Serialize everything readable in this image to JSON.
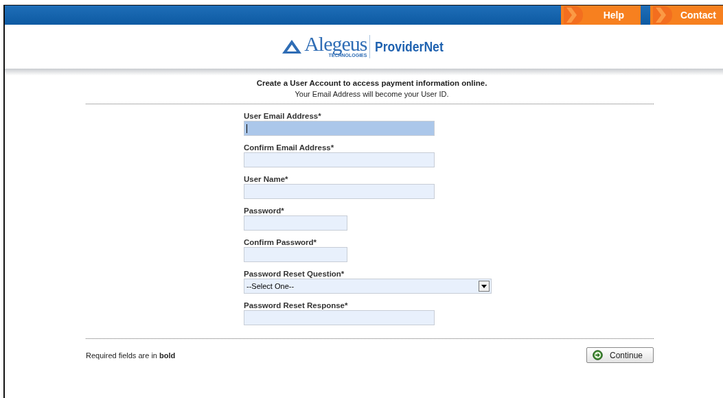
{
  "nav": [
    {
      "label": "Help"
    },
    {
      "label": "Contact"
    }
  ],
  "logo": {
    "brand": "Alegeus",
    "sub": "TECHNOLOGIES",
    "product": "ProviderNet"
  },
  "intro": {
    "title": "Create a User Account to access payment information online.",
    "note": "Your Email Address will become your User ID."
  },
  "fields": [
    {
      "label": "User Email Address*",
      "kind": "text",
      "focused": true
    },
    {
      "label": "Confirm Email Address*",
      "kind": "text",
      "focused": false
    },
    {
      "label": "User Name*",
      "kind": "text",
      "focused": false
    },
    {
      "label": "Password*",
      "kind": "password",
      "focused": false
    },
    {
      "label": "Confirm Password*",
      "kind": "password",
      "focused": false
    },
    {
      "label": "Password Reset Question*",
      "kind": "select",
      "value": "--Select One--",
      "focused": false
    },
    {
      "label": "Password Reset Response*",
      "kind": "text",
      "focused": false
    }
  ],
  "footer": {
    "note": "Required fields are in **bold**",
    "button": "Continue"
  }
}
